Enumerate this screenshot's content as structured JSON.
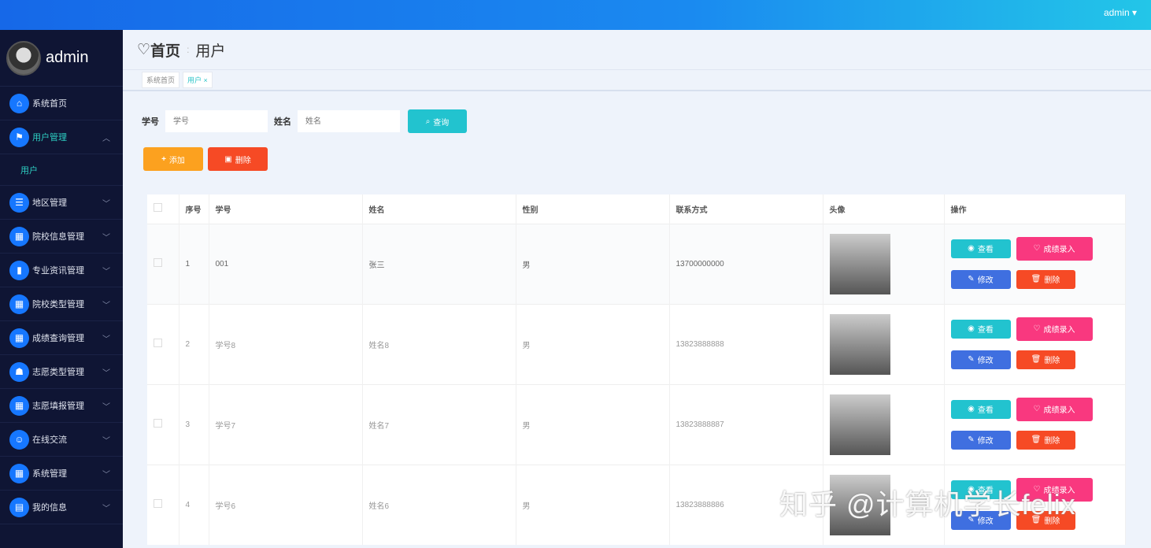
{
  "topbar": {
    "user": "admin ▾"
  },
  "sidebar": {
    "brand": "admin",
    "items": [
      {
        "label": "系统首页",
        "icon": "⌂"
      },
      {
        "label": "用户管理",
        "icon": "⚑",
        "expanded": true,
        "sub": [
          "用户"
        ]
      },
      {
        "label": "地区管理",
        "icon": "☰"
      },
      {
        "label": "院校信息管理",
        "icon": "▦"
      },
      {
        "label": "专业资讯管理",
        "icon": "▮"
      },
      {
        "label": "院校类型管理",
        "icon": "▦"
      },
      {
        "label": "成绩查询管理",
        "icon": "▦"
      },
      {
        "label": "志愿类型管理",
        "icon": "☗"
      },
      {
        "label": "志愿填报管理",
        "icon": "▦"
      },
      {
        "label": "在线交流",
        "icon": "☺"
      },
      {
        "label": "系统管理",
        "icon": "▦"
      },
      {
        "label": "我的信息",
        "icon": "▤"
      }
    ]
  },
  "header": {
    "home": "首页",
    "current": "用户"
  },
  "tabs": [
    "系统首页",
    "用户 ×"
  ],
  "search": {
    "label1": "学号",
    "placeholder1": "学号",
    "label2": "姓名",
    "placeholder2": "姓名",
    "button": "查询"
  },
  "actions": {
    "add": "添加",
    "delete": "删除"
  },
  "table": {
    "headers": [
      "序号",
      "学号",
      "姓名",
      "性别",
      "联系方式",
      "头像",
      "操作"
    ],
    "rows": [
      [
        "1",
        "001",
        "张三",
        "男",
        "13700000000"
      ],
      [
        "2",
        "学号8",
        "姓名8",
        "男",
        "13823888888"
      ],
      [
        "3",
        "学号7",
        "姓名7",
        "男",
        "13823888887"
      ],
      [
        "4",
        "学号6",
        "姓名6",
        "男",
        "13823888886"
      ]
    ],
    "ops": {
      "view": "查看",
      "score": "成绩录入",
      "edit": "修改",
      "delete": "删除"
    }
  },
  "watermark": "知乎 @计算机学长felix"
}
